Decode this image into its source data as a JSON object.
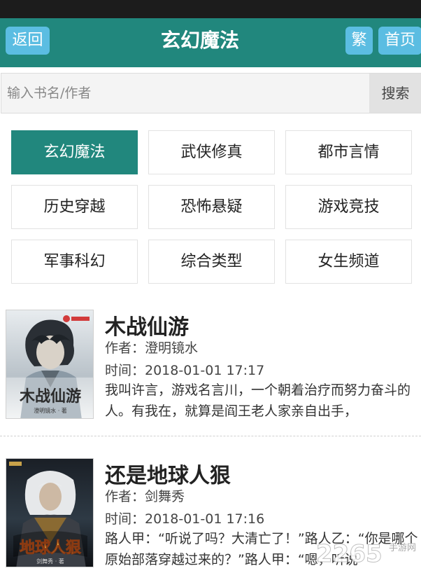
{
  "header": {
    "back_label": "返回",
    "title": "玄幻魔法",
    "traditional_label": "繁",
    "home_label": "首页"
  },
  "search": {
    "placeholder": "输入书名/作者",
    "button_label": "搜索"
  },
  "categories": [
    {
      "label": "玄幻魔法",
      "active": true
    },
    {
      "label": "武侠修真",
      "active": false
    },
    {
      "label": "都市言情",
      "active": false
    },
    {
      "label": "历史穿越",
      "active": false
    },
    {
      "label": "恐怖悬疑",
      "active": false
    },
    {
      "label": "游戏竞技",
      "active": false
    },
    {
      "label": "军事科幻",
      "active": false
    },
    {
      "label": "综合类型",
      "active": false
    },
    {
      "label": "女生频道",
      "active": false
    }
  ],
  "books": [
    {
      "title": "木战仙游",
      "author": "作者：澄明镜水",
      "time": "时间：2018-01-01 17:17",
      "description": "我叫许言，游戏名言川，一个朝着治疗而努力奋斗的人。有我在，就算是阎王老人家亲自出手，",
      "cover_text": "木战仙游",
      "cover_author": "澄明镜水 · 著"
    },
    {
      "title": "还是地球人狠",
      "author": "作者：剑舞秀",
      "time": "时间：2018-01-01 17:16",
      "description": "路人甲：“听说了吗？大清亡了！”路人乙：“你是哪个原始部落穿越过来的？”路人甲：“嗯，听说",
      "cover_text": "地球人狠",
      "cover_author": "剑舞秀 · 著"
    }
  ],
  "watermark": {
    "text": "2265",
    "sub_text": "手游网"
  },
  "colors": {
    "accent": "#21877d",
    "header_button": "#5bbde2",
    "status_bar": "#1c1c1c"
  }
}
